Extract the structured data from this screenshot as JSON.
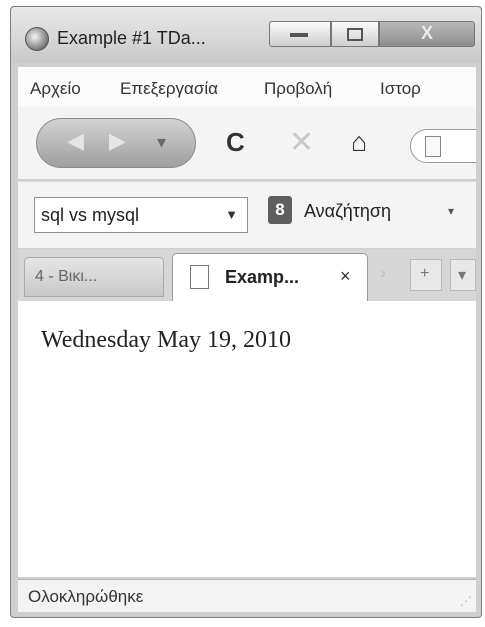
{
  "window": {
    "title": "Example #1 TDa...",
    "minimize_glyph": "",
    "close_glyph": "X"
  },
  "menubar": {
    "items": [
      "Αρχείο",
      "Επεξεργασία",
      "Προβολή",
      "Ιστορ"
    ]
  },
  "nav": {
    "back_glyph": "◀",
    "forward_glyph": "▶",
    "dropdown_glyph": "▾",
    "reload_glyph": "C",
    "stop_glyph": "✕",
    "home_glyph": "⌂"
  },
  "search": {
    "value": "sql vs mysql",
    "dropdown_glyph": "▼",
    "engine_icon_text": "8",
    "engine_label": "Αναζήτηση",
    "engine_dropdown_glyph": "▾"
  },
  "tabs": {
    "items": [
      {
        "label": "4 - Βικι...",
        "active": false
      },
      {
        "label": "Examp...",
        "active": true
      }
    ],
    "close_glyph": "×",
    "scroll_glyph": "›",
    "new_tab_glyph": "+",
    "list_glyph": "▾"
  },
  "content": {
    "text": "Wednesday May 19, 2010"
  },
  "status": {
    "text": "Ολοκληρώθηκε"
  }
}
